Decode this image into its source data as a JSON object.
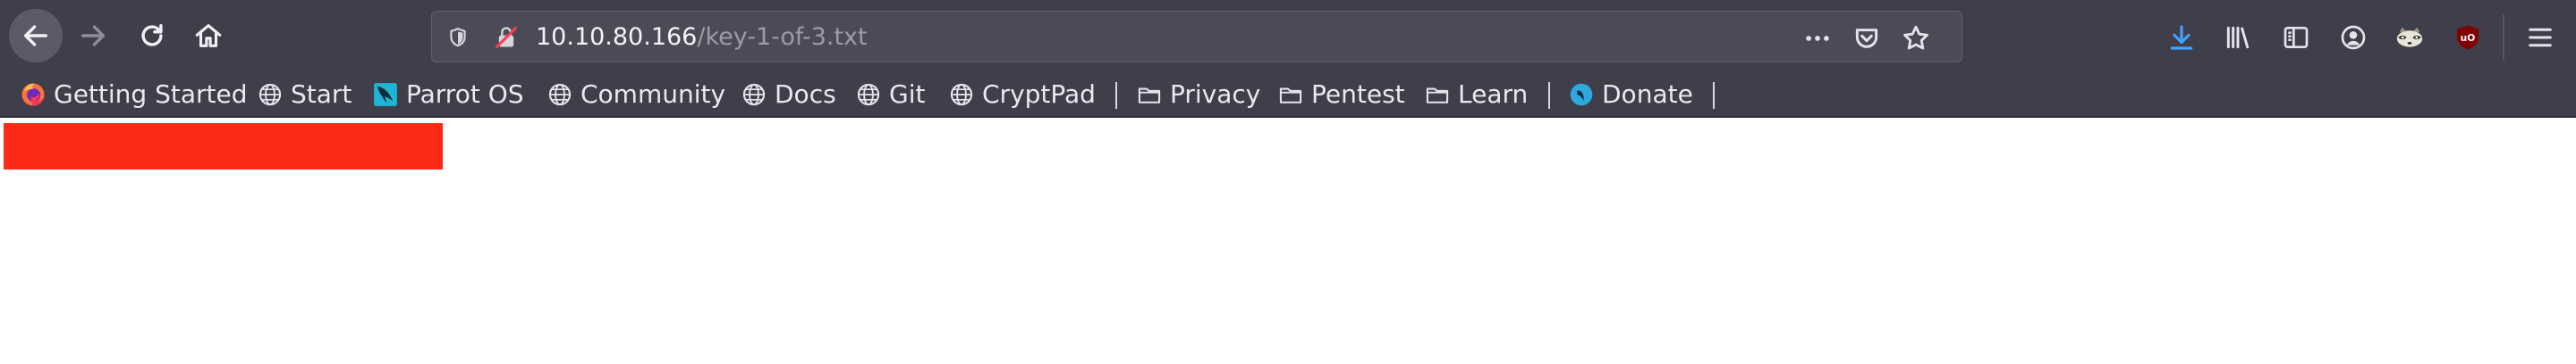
{
  "browser": {
    "url": {
      "host": "10.10.80.166",
      "path": "/key-1-of-3.txt"
    },
    "nav_icons": [
      "back-arrow-icon",
      "forward-arrow-icon",
      "reload-icon",
      "home-icon"
    ],
    "url_icons": [
      "tracking-shield-icon",
      "insecure-lock-icon",
      "page-actions-dots-icon",
      "pocket-icon",
      "bookmark-star-icon"
    ],
    "toolbar_icons": [
      "download-arrow-icon",
      "library-icon",
      "sidebar-icon",
      "account-icon",
      "extension-raccoon-icon",
      "ublock-origin-icon",
      "hamburger-menu-icon"
    ],
    "colors": {
      "toolbar": "#3e3f4a",
      "urlbar": "#4a4b56",
      "download_accent": "#45a1ff",
      "ublock_red": "#800000",
      "redaction": "#fc2a16"
    }
  },
  "bookmarks": {
    "items": [
      {
        "label": "Getting Started",
        "icon": "firefox-icon"
      },
      {
        "label": "Start",
        "icon": "globe-icon"
      },
      {
        "label": "Parrot OS",
        "icon": "parrot-icon"
      },
      {
        "label": "Community",
        "icon": "globe-icon"
      },
      {
        "label": "Docs",
        "icon": "globe-icon"
      },
      {
        "label": "Git",
        "icon": "globe-icon"
      },
      {
        "label": "CryptPad",
        "icon": "globe-icon"
      }
    ],
    "folders": [
      {
        "label": "Privacy",
        "icon": "folder-icon"
      },
      {
        "label": "Pentest",
        "icon": "folder-icon"
      },
      {
        "label": "Learn",
        "icon": "folder-icon"
      }
    ],
    "donate": {
      "label": "Donate",
      "icon": "donate-icon"
    }
  },
  "page": {
    "content": "redacted"
  }
}
